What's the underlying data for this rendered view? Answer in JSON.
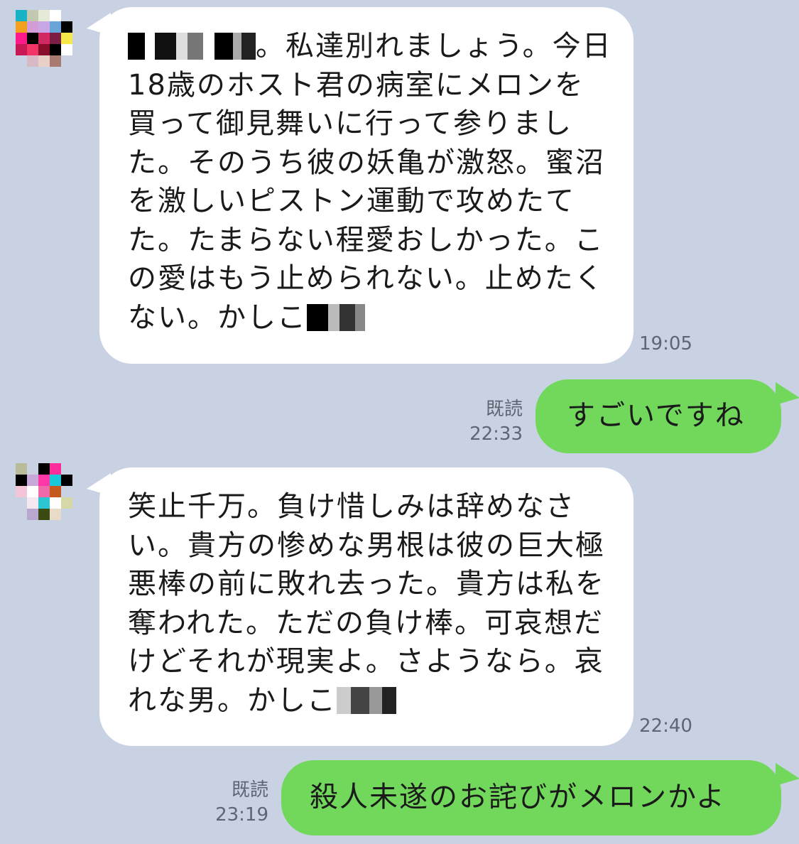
{
  "messages": [
    {
      "id": "m1",
      "direction": "incoming",
      "text_after_redaction": "。私達別れましょう。今日18歳のホスト君の病室にメロンを買って御見舞いに行って参りました。そのうち彼の妖亀が激怒。蜜沼を激しいピストン運動で攻めたてた。たまらない程愛おしかった。この愛はもう止められない。止めたくない。かしこ",
      "time": "19:05"
    },
    {
      "id": "m2",
      "direction": "outgoing",
      "text": "すごいですね",
      "read_label": "既読",
      "time": "22:33"
    },
    {
      "id": "m3",
      "direction": "incoming",
      "text": "笑止千万。負け惜しみは辞めなさい。貴方の惨めな男根は彼の巨大極悪棒の前に敗れ去った。貴方は私を奪われた。ただの負け棒。可哀想だけどそれが現実よ。さようなら。哀れな男。かしこ",
      "time": "22:40"
    },
    {
      "id": "m4",
      "direction": "outgoing",
      "text": "殺人未遂のお詫びがメロンかよ",
      "read_label": "既読",
      "time": "23:19"
    }
  ],
  "colors": {
    "background": "#c9d2e2",
    "incoming_bubble": "#ffffff",
    "outgoing_bubble": "#71d85c"
  }
}
